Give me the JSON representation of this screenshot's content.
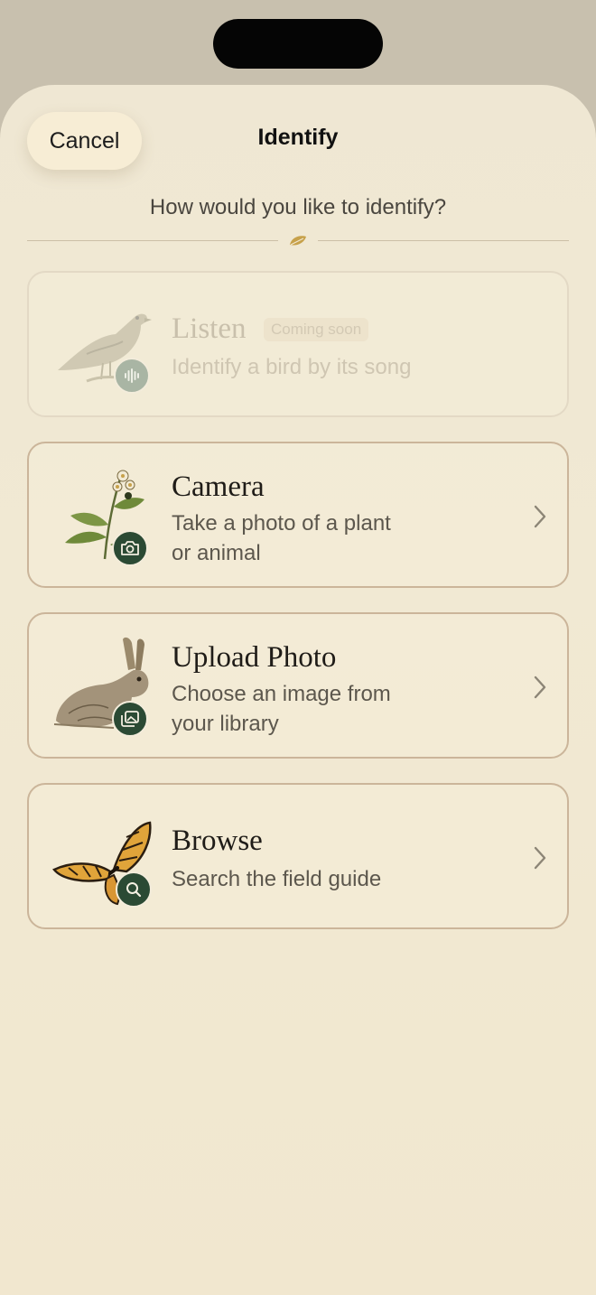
{
  "header": {
    "cancel_label": "Cancel",
    "title": "Identify",
    "subtitle": "How would you like to identify?"
  },
  "options": [
    {
      "title": "Listen",
      "badge_text": "Coming soon",
      "description": "Identify a bird by its song",
      "icon": "waveform-icon",
      "illustration": "bird-illustration",
      "enabled": false
    },
    {
      "title": "Camera",
      "description_line1": "Take a photo of a plant",
      "description_line2": "or animal",
      "icon": "camera-icon",
      "illustration": "flower-illustration",
      "enabled": true
    },
    {
      "title": "Upload Photo",
      "description_line1": "Choose an image from",
      "description_line2": "your library",
      "icon": "photo-library-icon",
      "illustration": "rabbit-illustration",
      "enabled": true
    },
    {
      "title": "Browse",
      "description": "Search the field guide",
      "icon": "search-icon",
      "illustration": "butterfly-illustration",
      "enabled": true
    }
  ],
  "colors": {
    "sheet_background": "#efe7d3",
    "card_border": "#cbb59a",
    "badge_green": "#2b4a34",
    "badge_gray": "#a9b5a4",
    "accent_gold": "#c7a14a"
  }
}
